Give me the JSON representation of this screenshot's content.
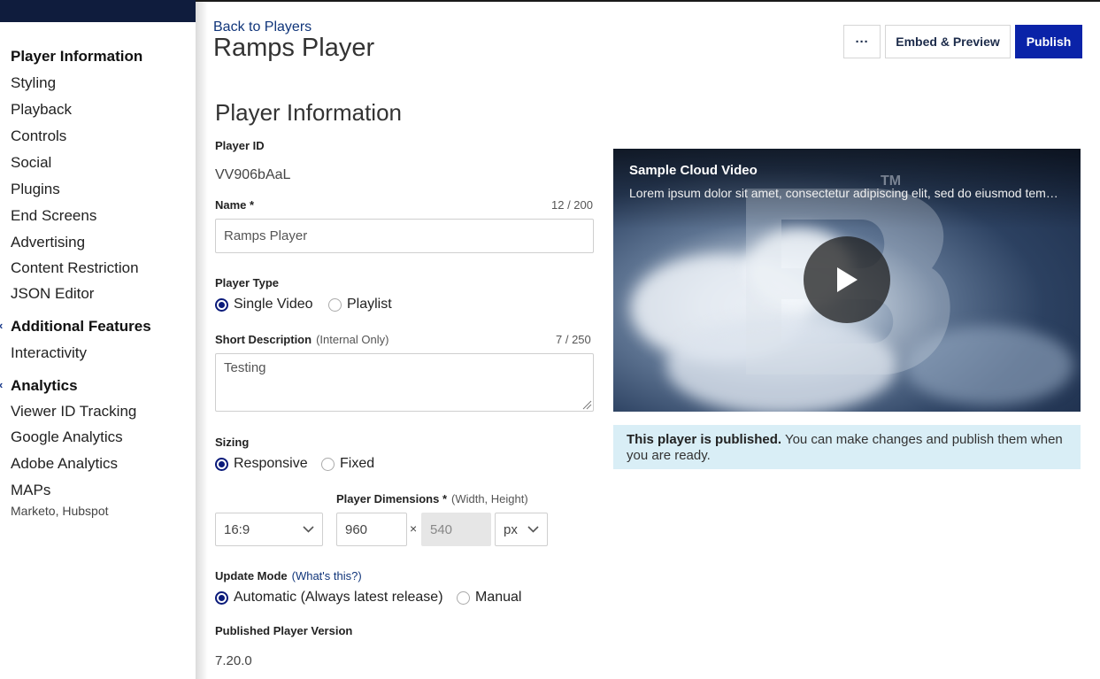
{
  "sidebar": {
    "items": [
      {
        "label": "Player Information",
        "kind": "active"
      },
      {
        "label": "Styling"
      },
      {
        "label": "Playback"
      },
      {
        "label": "Controls"
      },
      {
        "label": "Social"
      },
      {
        "label": "Plugins"
      },
      {
        "label": "End Screens"
      },
      {
        "label": "Advertising"
      },
      {
        "label": "Content Restriction"
      },
      {
        "label": "JSON Editor"
      }
    ],
    "additional_features": {
      "heading": "Additional Features",
      "items": [
        "Interactivity"
      ]
    },
    "analytics": {
      "heading": "Analytics",
      "items": [
        "Viewer ID Tracking",
        "Google Analytics",
        "Adobe Analytics",
        "MAPs"
      ],
      "maps_sub": "Marketo, Hubspot"
    }
  },
  "header": {
    "back_link": "Back to Players",
    "title": "Ramps Player",
    "more_label": "···",
    "embed_label": "Embed & Preview",
    "publish_label": "Publish"
  },
  "form": {
    "section_title": "Player Information",
    "player_id_label": "Player ID",
    "player_id_value": "VV906bAaL",
    "name_label": "Name *",
    "name_counter": "12 / 200",
    "name_value": "Ramps Player",
    "player_type_label": "Player Type",
    "player_type_options": [
      "Single Video",
      "Playlist"
    ],
    "player_type_selected": "Single Video",
    "short_desc_label": "Short Description",
    "short_desc_note": "(Internal Only)",
    "short_desc_counter": "7 / 250",
    "short_desc_value": "Testing",
    "sizing_label": "Sizing",
    "sizing_options": [
      "Responsive",
      "Fixed"
    ],
    "sizing_selected": "Responsive",
    "aspect_ratio": "16:9",
    "dimensions_label": "Player Dimensions *",
    "dimensions_note": "(Width, Height)",
    "width": "960",
    "times": "×",
    "height": "540",
    "unit": "px",
    "update_mode_label": "Update Mode",
    "update_mode_link": "(What's this?)",
    "update_mode_options": [
      "Automatic (Always latest release)",
      "Manual"
    ],
    "update_mode_selected": "Automatic (Always latest release)",
    "published_version_label": "Published Player Version",
    "published_version_value": "7.20.0"
  },
  "preview": {
    "video_title": "Sample Cloud Video",
    "video_description": "Lorem ipsum dolor sit amet, consectetur adipiscing elit, sed do eiusmod tem…",
    "logo_tm": "TM",
    "notice_bold": "This player is published.",
    "notice_text": " You can make changes and publish them when you are ready."
  },
  "colors": {
    "accent": "#0a23a8",
    "link": "#10357a",
    "topbar": "#0f1c3d",
    "notice_bg": "#d9eef6"
  }
}
